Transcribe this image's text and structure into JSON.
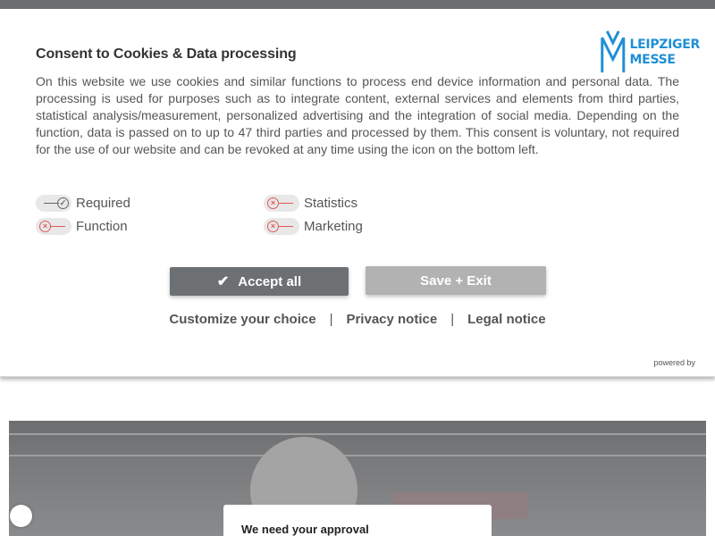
{
  "dialog": {
    "title": "Consent to Cookies & Data processing",
    "body": "On this website we use cookies and similar functions to process end device information and personal data. The processing is used for purposes such as to integrate content, external services and elements from third parties, statistical analysis/measurement, personalized advertising and the integration of social media. Depending on the function, data is passed on to up to 47 third parties and processed by them. This consent is voluntary, not required for the use of our website and can be revoked at any time using the icon on the bottom left.",
    "logo": {
      "line1": "LEIPZIGER",
      "line2": "MESSE",
      "color": "#1f8fd6"
    },
    "toggles": [
      {
        "label": "Required",
        "enabled": true
      },
      {
        "label": "Function",
        "enabled": false
      },
      {
        "label": "Statistics",
        "enabled": false
      },
      {
        "label": "Marketing",
        "enabled": false
      }
    ],
    "buttons": {
      "accept_all": "Accept all",
      "save_exit": "Save + Exit"
    },
    "links": {
      "customize": "Customize your choice",
      "privacy": "Privacy notice",
      "legal": "Legal notice",
      "separator": "|"
    },
    "powered_by": "powered by"
  },
  "background": {
    "approval_title": "We need your approval"
  },
  "colors": {
    "accept_button": "#6c7073",
    "save_button": "#b2b2b2",
    "toggle_off": "#e05a5a",
    "toggle_on": "#666666",
    "brand": "#1f8fd6"
  }
}
